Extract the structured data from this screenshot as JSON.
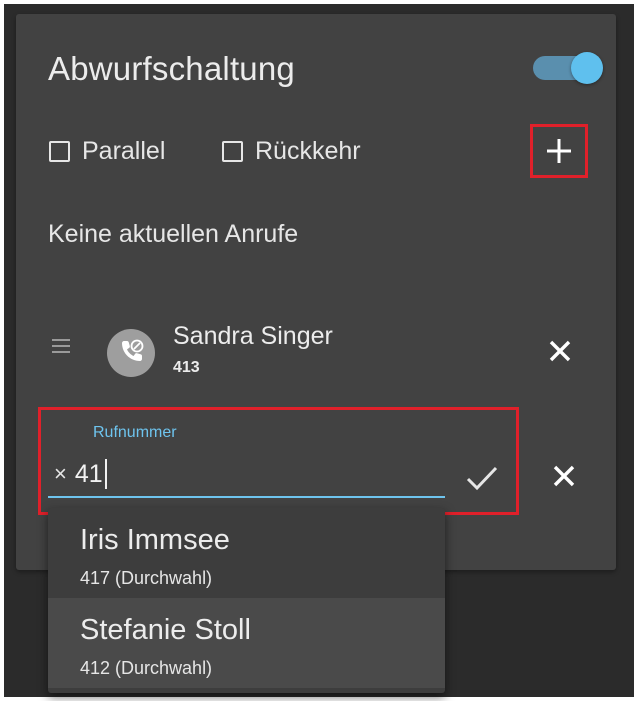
{
  "panel": {
    "title": "Abwurfschaltung",
    "enabled": true,
    "checkboxes": [
      {
        "label": "Parallel",
        "checked": false
      },
      {
        "label": "Rückkehr",
        "checked": false
      }
    ],
    "add_icon": "plus-icon",
    "status_text": "Keine aktuellen Anrufe"
  },
  "contact": {
    "name": "Sandra Singer",
    "number": "413",
    "avatar_icon": "phone-forward-icon",
    "remove_icon": "close-icon"
  },
  "number_field": {
    "label": "Rufnummer",
    "clear_glyph": "×",
    "value": "41",
    "confirm_icon": "check-icon",
    "remove_icon": "close-icon"
  },
  "suggestions": [
    {
      "name": "Iris Immsee",
      "detail": "417 (Durchwahl)"
    },
    {
      "name": "Stefanie Stoll",
      "detail": "412 (Durchwahl)"
    }
  ],
  "colors": {
    "accent": "#6ec4ee",
    "highlight_border": "#e0202a",
    "card": "#424242",
    "background": "#2b2b2b"
  }
}
